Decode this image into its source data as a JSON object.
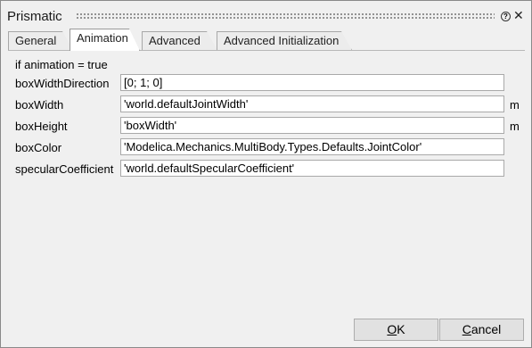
{
  "window": {
    "title": "Prismatic",
    "help_icon": "question-icon",
    "close_icon": "close-icon",
    "close_glyph": "✕"
  },
  "tabs": [
    {
      "label": "General"
    },
    {
      "label": "Animation",
      "active": true
    },
    {
      "label": "Advanced"
    },
    {
      "label": "Advanced Initialization"
    }
  ],
  "section": {
    "note": "if animation = true"
  },
  "params": [
    {
      "label": "boxWidthDirection",
      "value": "[0; 1; 0]",
      "unit": ""
    },
    {
      "label": "boxWidth",
      "value": "'world.defaultJointWidth'",
      "unit": "m"
    },
    {
      "label": "boxHeight",
      "value": "'boxWidth'",
      "unit": "m"
    },
    {
      "label": "boxColor",
      "value": "'Modelica.Mechanics.MultiBody.Types.Defaults.JointColor'",
      "unit": ""
    },
    {
      "label": "specularCoefficient",
      "value": "'world.defaultSpecularCoefficient'",
      "unit": ""
    }
  ],
  "buttons": {
    "ok": {
      "mnemonic": "O",
      "rest": "K"
    },
    "cancel": {
      "mnemonic": "C",
      "rest": "ancel"
    }
  }
}
